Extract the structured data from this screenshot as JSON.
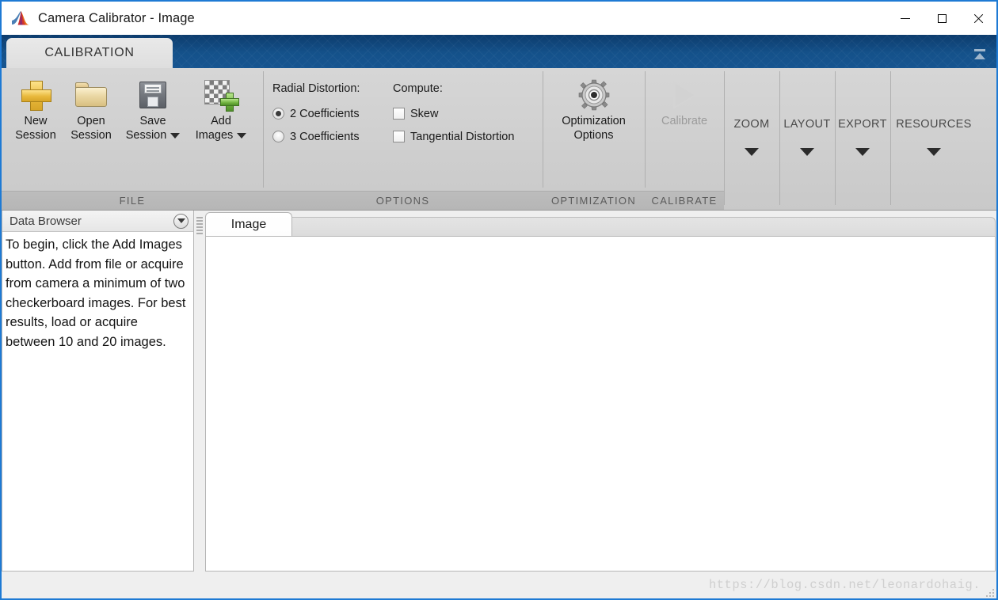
{
  "window": {
    "title": "Camera Calibrator - Image",
    "logo_icon": "matlab-membrane-icon",
    "minimize_label": "Minimize",
    "maximize_label": "Maximize",
    "close_label": "Close",
    "accent_border_color": "#1e7ad4"
  },
  "ribbon": {
    "tab_label": "CALIBRATION",
    "collapse_icon": "collapse-ribbon-icon",
    "background_color": "#14518a",
    "groups": [
      {
        "id": "file",
        "footer": "FILE",
        "buttons": [
          {
            "label_line1": "New",
            "label_line2": "Session",
            "icon": "new-session-plus-icon",
            "has_dropdown": false,
            "disabled": false
          },
          {
            "label_line1": "Open",
            "label_line2": "Session",
            "icon": "open-session-folder-icon",
            "has_dropdown": false,
            "disabled": false
          },
          {
            "label_line1": "Save",
            "label_line2": "Session",
            "icon": "save-session-floppy-icon",
            "has_dropdown": true,
            "disabled": false
          },
          {
            "label_line1": "Add",
            "label_line2": "Images",
            "icon": "add-images-checkerboard-icon",
            "has_dropdown": true,
            "disabled": false
          }
        ]
      },
      {
        "id": "options",
        "footer": "OPTIONS",
        "radial_distortion_label": "Radial Distortion:",
        "compute_label": "Compute:",
        "radios": [
          {
            "label": "2 Coefficients",
            "selected": true
          },
          {
            "label": "3 Coefficients",
            "selected": false
          }
        ],
        "checkboxes": [
          {
            "label": "Skew",
            "checked": false
          },
          {
            "label": "Tangential Distortion",
            "checked": false
          }
        ]
      },
      {
        "id": "optimization",
        "footer": "OPTIMIZATION",
        "buttons": [
          {
            "label_line1": "Optimization",
            "label_line2": "Options",
            "icon": "gear-icon",
            "has_dropdown": false,
            "disabled": false
          }
        ]
      },
      {
        "id": "calibrate",
        "footer": "CALIBRATE",
        "buttons": [
          {
            "label_line1": "Calibrate",
            "label_line2": "",
            "icon": "play-triangle-icon",
            "has_dropdown": false,
            "disabled": true
          }
        ]
      }
    ],
    "collapsed_groups": [
      {
        "label": "ZOOM",
        "icon": "chevron-down-icon"
      },
      {
        "label": "LAYOUT",
        "icon": "chevron-down-icon"
      },
      {
        "label": "EXPORT",
        "icon": "chevron-down-icon"
      },
      {
        "label": "RESOURCES",
        "icon": "chevron-down-icon"
      }
    ]
  },
  "data_browser": {
    "title": "Data Browser",
    "dropdown_icon": "circle-chevron-down-icon",
    "message": "To begin, click the Add Images button. Add from file or acquire from camera a minimum of two checkerboard images. For best results, load or acquire between 10 and 20 images."
  },
  "document_area": {
    "tab_label": "Image",
    "splitter_icon": "drag-handle-icon"
  },
  "status_bar": {
    "watermark": "https://blog.csdn.net/leonardohaig.",
    "resize_grip_icon": "resize-grip-icon"
  }
}
